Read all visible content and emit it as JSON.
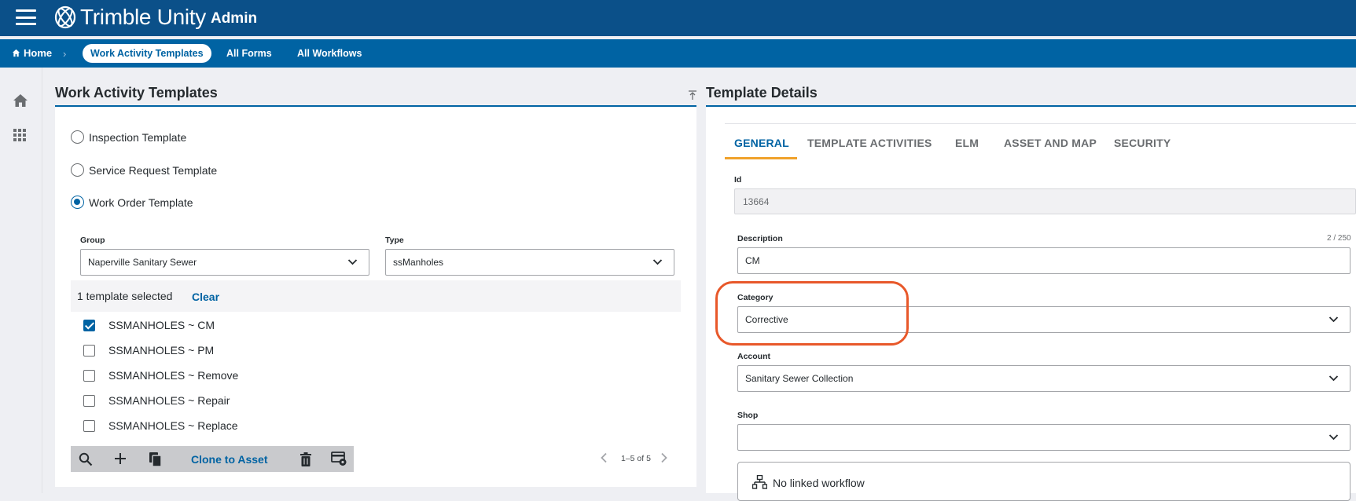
{
  "app": {
    "brand_name": "Trimble Unity",
    "brand_sub": "Admin"
  },
  "colors": {
    "header_bg": "#0b5089",
    "nav_bg": "#0063a3",
    "accent": "#0063a3",
    "tab_indicator": "#f0a22b",
    "annotation": "#e8582a"
  },
  "nav": {
    "home_label": "Home",
    "active_tab": "Work Activity Templates",
    "links": [
      "All Forms",
      "All Workflows"
    ]
  },
  "left": {
    "title": "Work Activity Templates",
    "radios": [
      {
        "label": "Inspection Template",
        "checked": false
      },
      {
        "label": "Service Request Template",
        "checked": false
      },
      {
        "label": "Work Order Template",
        "checked": true
      }
    ],
    "group_label": "Group",
    "group_value": "Naperville Sanitary Sewer",
    "type_label": "Type",
    "type_value": "ssManholes",
    "selected_text": "1 template selected",
    "clear_label": "Clear",
    "templates": [
      {
        "label": "SSMANHOLES ~ CM",
        "checked": true
      },
      {
        "label": "SSMANHOLES ~ PM",
        "checked": false
      },
      {
        "label": "SSMANHOLES ~ Remove",
        "checked": false
      },
      {
        "label": "SSMANHOLES ~ Repair",
        "checked": false
      },
      {
        "label": "SSMANHOLES ~ Replace",
        "checked": false
      }
    ],
    "toolbar": {
      "icons": [
        "search-icon",
        "add-icon",
        "copy-icon",
        "delete-icon",
        "settings-card-icon"
      ],
      "clone_label": "Clone to Asset"
    },
    "pager_text": "1–5 of 5"
  },
  "right": {
    "title": "Template Details",
    "tabs": [
      "GENERAL",
      "TEMPLATE ACTIVITIES",
      "ELM",
      "ASSET AND MAP",
      "SECURITY"
    ],
    "active_tab": "GENERAL",
    "id_label": "Id",
    "id_value": "13664",
    "description_label": "Description",
    "description_counter": "2 / 250",
    "description_value": "CM",
    "category_label": "Category",
    "category_value": "Corrective",
    "account_label": "Account",
    "account_value": "Sanitary Sewer Collection",
    "shop_label": "Shop",
    "shop_value": "",
    "workflow_text": "No linked workflow"
  }
}
